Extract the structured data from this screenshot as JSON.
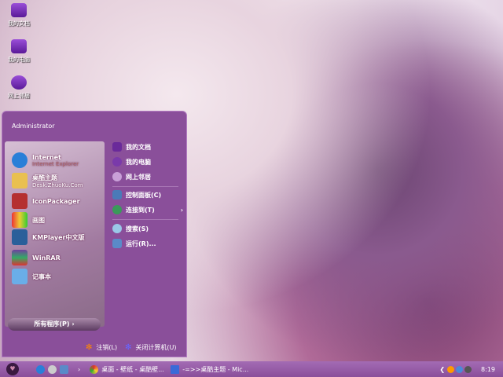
{
  "desktop": {
    "icons": [
      {
        "label": "我的文档"
      },
      {
        "label": "我的电脑"
      },
      {
        "label": "网上邻居"
      }
    ]
  },
  "start_menu": {
    "user": "Administrator",
    "programs": [
      {
        "label": "Internet",
        "sub": "Internet Explorer"
      },
      {
        "label": "桌酷主题",
        "sub": "Desk.ZhuoKu.Com"
      },
      {
        "label": "IconPackager"
      },
      {
        "label": "画图"
      },
      {
        "label": "KMPlayer中文版"
      },
      {
        "label": "WinRAR"
      },
      {
        "label": "记事本"
      }
    ],
    "all_programs": "所有程序(P)",
    "places": [
      {
        "label": "我的文档"
      },
      {
        "label": "我的电脑"
      },
      {
        "label": "网上邻居"
      },
      {
        "label": "控制面板(C)"
      },
      {
        "label": "连接到(T)"
      },
      {
        "label": "搜索(S)"
      },
      {
        "label": "运行(R)..."
      }
    ],
    "logoff": "注销(L)",
    "shutdown": "关闭计算机(U)"
  },
  "taskbar": {
    "tasks": [
      {
        "label": "桌面 - 壁纸 - 桌酷壁..."
      },
      {
        "label": "-=>>桌酷主题 - Mic..."
      }
    ],
    "quicklaunch_more": "›",
    "clock": "8:19"
  }
}
